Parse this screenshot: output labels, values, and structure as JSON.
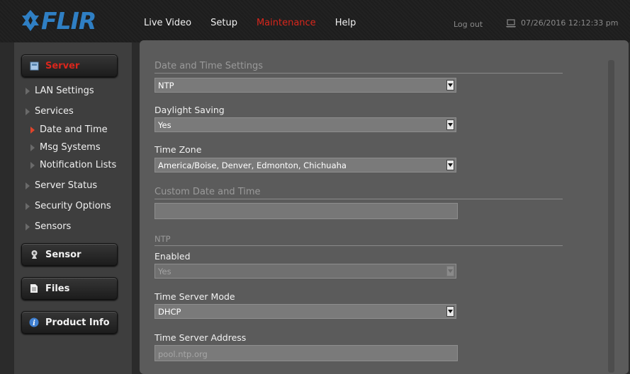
{
  "header": {
    "logo_text": "FLIR",
    "nav": [
      "Live Video",
      "Setup",
      "Maintenance",
      "Help"
    ],
    "active_nav": "Maintenance",
    "logout": "Log out",
    "datetime": "07/26/2016 12:12:33 pm"
  },
  "sidebar": {
    "server_button": "Server",
    "items": {
      "lan": "LAN Settings",
      "services": "Services",
      "date_time": "Date and Time",
      "msg_systems": "Msg Systems",
      "notification_lists": "Notification Lists",
      "server_status": "Server Status",
      "security_options": "Security Options",
      "sensors": "Sensors"
    },
    "sensor_button": "Sensor",
    "files_button": "Files",
    "product_info_button": "Product Info"
  },
  "main": {
    "date_time_settings": {
      "title": "Date and Time Settings",
      "mode_value": "NTP",
      "daylight_label": "Daylight Saving",
      "daylight_value": "Yes",
      "timezone_label": "Time Zone",
      "timezone_value": "America/Boise, Denver, Edmonton, Chichuaha"
    },
    "custom": {
      "title": "Custom Date and Time",
      "value": ""
    },
    "ntp": {
      "title": "NTP",
      "enabled_label": "Enabled",
      "enabled_value": "Yes",
      "mode_label": "Time Server Mode",
      "mode_value": "DHCP",
      "address_label": "Time Server Address",
      "address_value": "pool.ntp.org"
    }
  },
  "colors": {
    "accent_red": "#d9261c",
    "logo_blue": "#2f7fc4"
  }
}
